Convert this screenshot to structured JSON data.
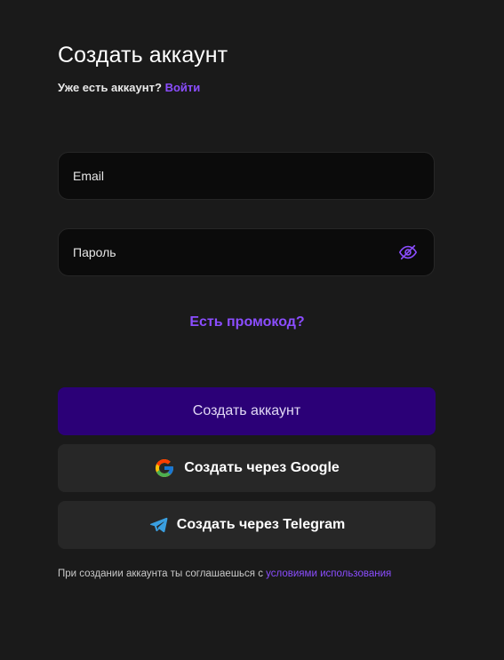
{
  "header": {
    "title": "Создать аккаунт",
    "have_account_text": "Уже есть аккаунт?",
    "login_link": "Войти"
  },
  "form": {
    "email": {
      "placeholder": "Email",
      "value": ""
    },
    "password": {
      "placeholder": "Пароль",
      "value": "",
      "visibility_icon": "eye-off-icon"
    },
    "promo_link": "Есть промокод?"
  },
  "actions": {
    "create_account": "Создать аккаунт",
    "google": {
      "label": "Создать через Google",
      "icon": "google-icon"
    },
    "telegram": {
      "label": "Создать через Telegram",
      "icon": "telegram-icon"
    }
  },
  "terms": {
    "text": "При создании аккаунта ты соглашаешься с",
    "link": "условиями использования"
  },
  "colors": {
    "background": "#1a1a1a",
    "accent": "#8b4dff",
    "primary_button": "#2b0077",
    "secondary_button": "#272727",
    "field_background": "#0b0b0b"
  }
}
